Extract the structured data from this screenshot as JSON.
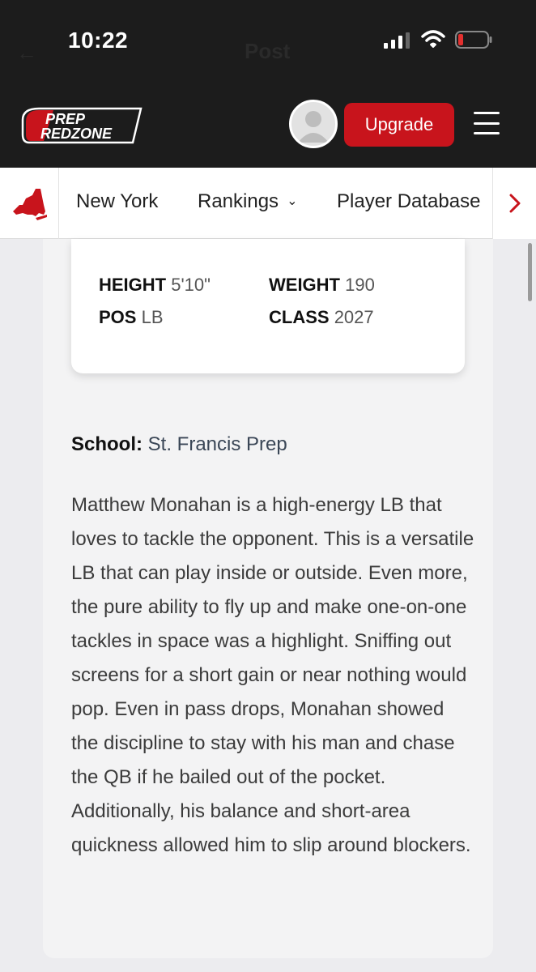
{
  "status_bar": {
    "time": "10:22",
    "ghost_title": "Post",
    "icons": [
      "signal-icon",
      "wifi-icon",
      "battery-icon"
    ]
  },
  "header": {
    "logo_line1": "PREP",
    "logo_line2": "REDZONE",
    "upgrade_label": "Upgrade",
    "brand_color": "#c8141c",
    "background": "#1c1c1c"
  },
  "nav": {
    "items": [
      {
        "label": "New York"
      },
      {
        "label": "Rankings"
      },
      {
        "label": "Player Database"
      }
    ]
  },
  "player": {
    "stats": [
      {
        "label": "HEIGHT",
        "value": "5'10\""
      },
      {
        "label": "WEIGHT",
        "value": "190"
      },
      {
        "label": "POS",
        "value": "LB"
      },
      {
        "label": "CLASS",
        "value": "2027"
      }
    ],
    "school_label": "School:",
    "school_value": "St. Francis Prep",
    "bio": "Matthew Monahan is a high-energy LB that loves to tackle the opponent. This is a versatile LB that can play inside or outside. Even more, the pure ability to fly up and make one-on-one tackles in space was a highlight. Sniffing out screens for a short gain or near nothing would pop. Even in pass drops, Monahan showed the discipline to stay with his man and chase the QB if he bailed out of the pocket. Additionally, his balance and short-area quickness allowed him to slip around blockers."
  }
}
